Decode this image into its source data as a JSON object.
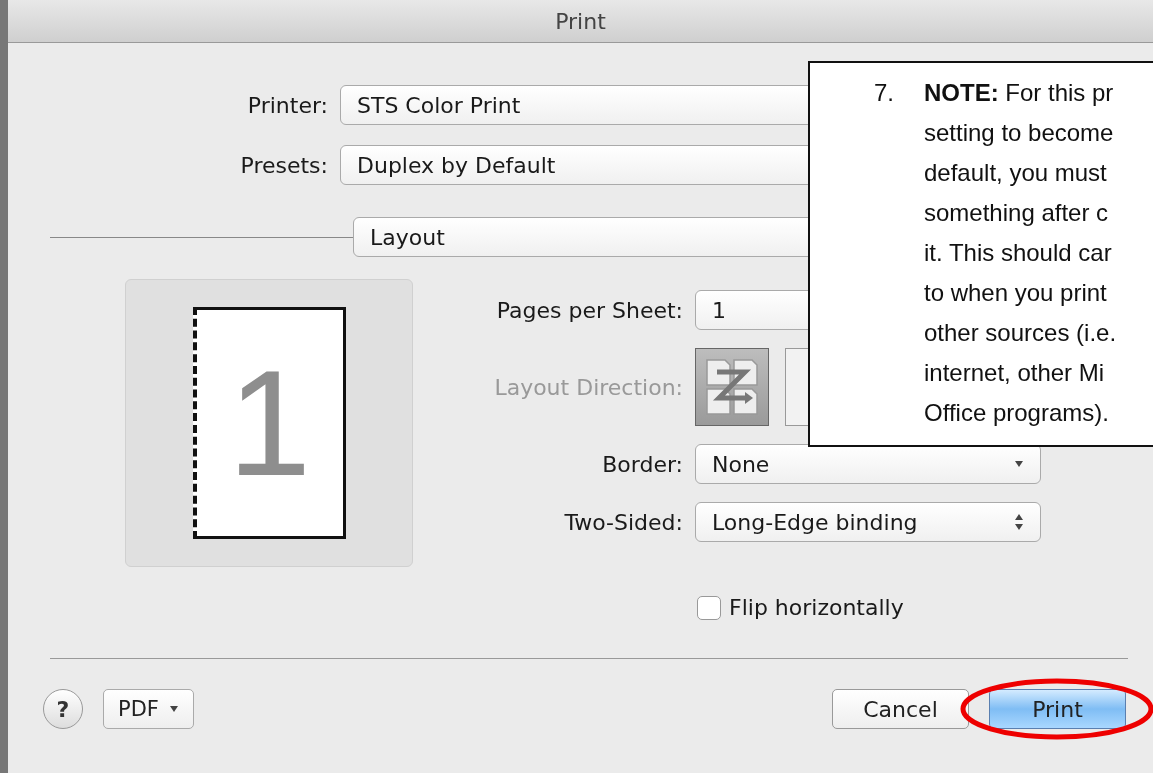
{
  "window": {
    "title": "Print"
  },
  "printer": {
    "label": "Printer:",
    "value": "STS Color Print"
  },
  "presets": {
    "label": "Presets:",
    "value": "Duplex by Default"
  },
  "section": {
    "value": "Layout"
  },
  "preview": {
    "page_number": "1"
  },
  "settings": [
    {
      "kind": "field",
      "label": "Pages per Sheet:",
      "value": "1",
      "disabled": false
    },
    {
      "kind": "direction",
      "label": "Layout Direction:",
      "disabled": true,
      "options": [
        {
          "selected": true
        },
        {
          "selected": false
        }
      ]
    },
    {
      "kind": "popup",
      "label": "Border:",
      "value": "None",
      "disabled": false
    },
    {
      "kind": "stepper",
      "label": "Two-Sided:",
      "value": "Long-Edge binding",
      "disabled": false
    }
  ],
  "flip": {
    "label": "Flip horizontally",
    "checked": false
  },
  "footer": {
    "help": "?",
    "pdf": "PDF"
  },
  "buttons": [
    {
      "label": "Cancel",
      "default": false,
      "circled": false
    },
    {
      "label": "Print",
      "default": true,
      "circled": true
    }
  ],
  "note": {
    "number": "7.",
    "lines": [
      "**NOTE:** For this pr",
      "setting to become",
      "default, you must",
      "something after c",
      "it. This should car",
      "to when you print",
      "other sources (i.e.",
      "internet, other Mi",
      "Office programs)."
    ]
  }
}
